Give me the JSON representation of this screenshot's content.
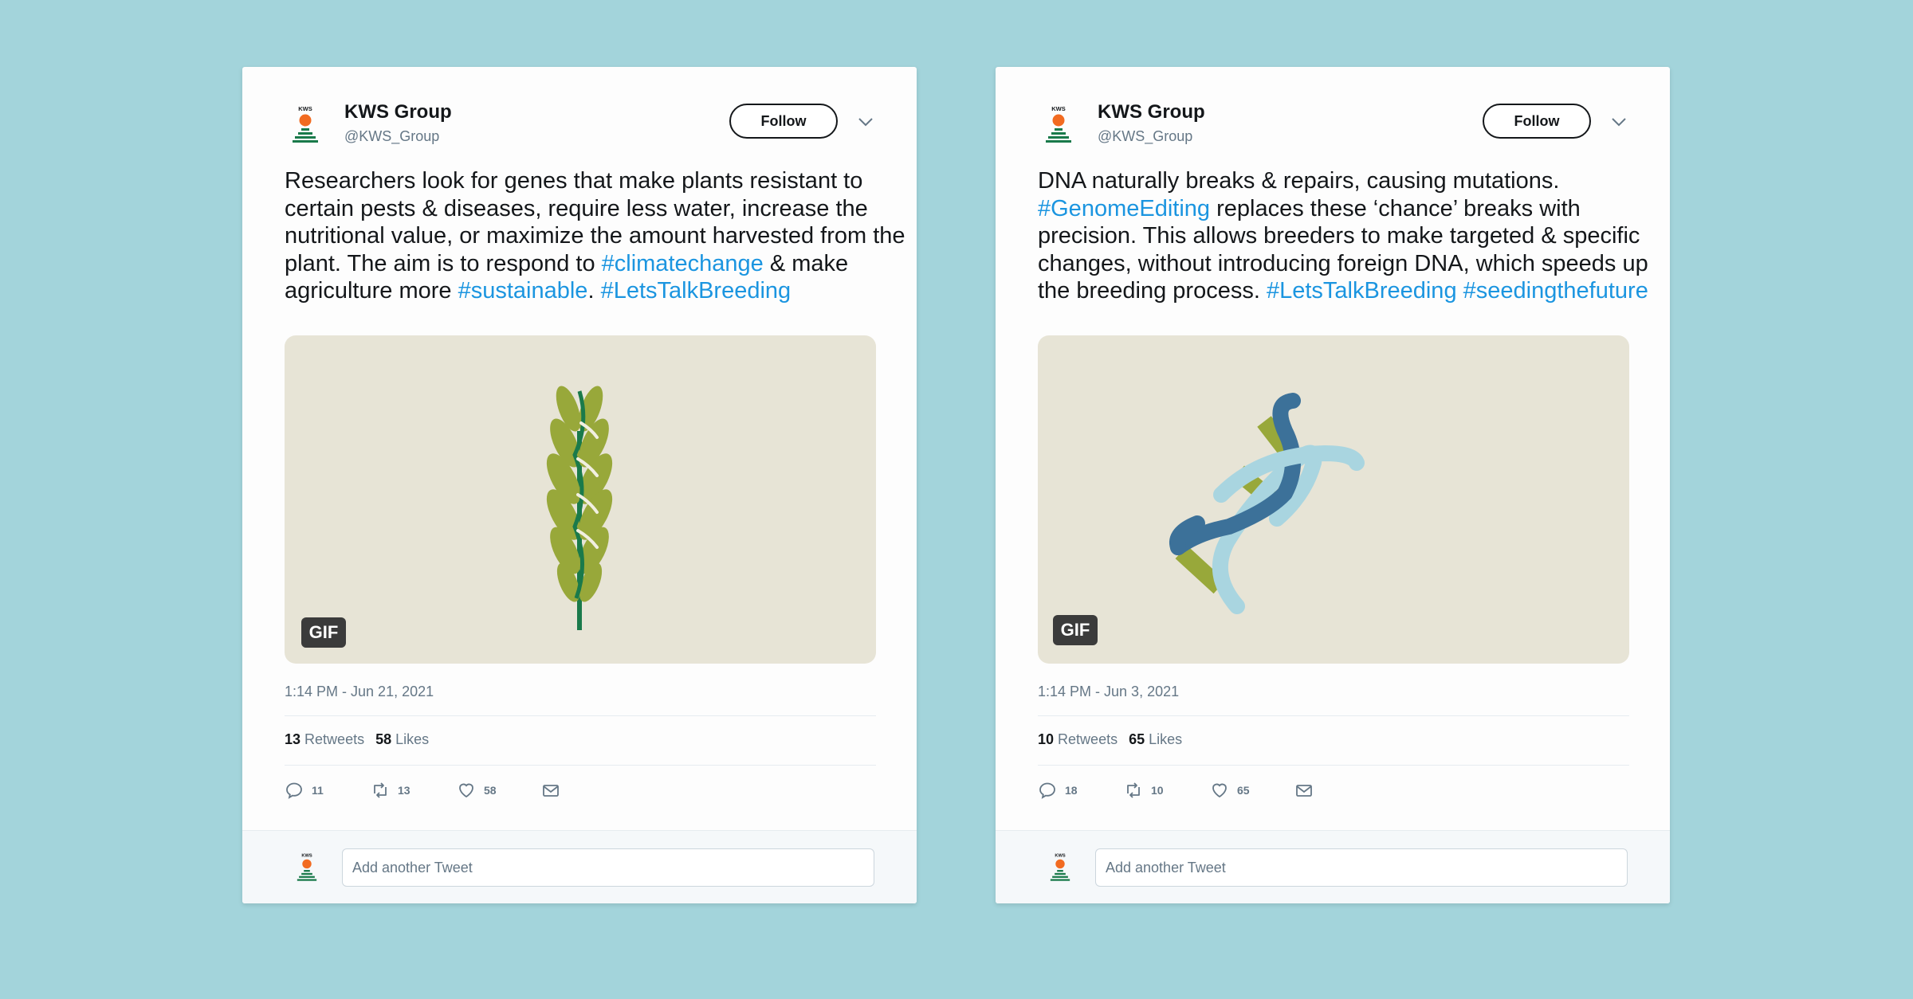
{
  "colors": {
    "background": "#a3d4db",
    "hashtag": "#1b95e0",
    "text": "#14171a",
    "muted": "#657786"
  },
  "tweets": [
    {
      "author": {
        "name": "KWS Group",
        "handle": "@KWS_Group",
        "logo_text": "KWS"
      },
      "follow_label": "Follow",
      "text_parts": [
        "Researchers look for genes that make plants resistant to certain pests & diseases, require less water, increase the nutritional value, or maximize the amount harvested from the plant. The aim is to respond to ",
        "#climatechange",
        " & make agriculture more ",
        "#sustainable",
        ". ",
        "#LetsTalkBreeding"
      ],
      "media_badge": "GIF",
      "media_icon": "wheat-ear-icon",
      "timestamp": "1:14 PM - Jun 21, 2021",
      "retweets": "13",
      "retweets_label": "Retweets",
      "likes": "58",
      "likes_label": "Likes",
      "actions": {
        "reply": "11",
        "retweet": "13",
        "like": "58"
      },
      "reply_placeholder": "Add another Tweet"
    },
    {
      "author": {
        "name": "KWS Group",
        "handle": "@KWS_Group",
        "logo_text": "KWS"
      },
      "follow_label": "Follow",
      "text_parts": [
        "DNA naturally breaks & repairs, causing mutations. ",
        "#GenomeEditing",
        " replaces these ‘chance’ breaks with precision. This allows breeders to make targeted & specific changes, without introducing foreign DNA, which speeds up the breeding process. ",
        "#LetsTalkBreeding",
        " ",
        "#seedingthefuture"
      ],
      "media_badge": "GIF",
      "media_icon": "dna-helix-icon",
      "timestamp": "1:14 PM - Jun 3, 2021",
      "retweets": "10",
      "retweets_label": "Retweets",
      "likes": "65",
      "likes_label": "Likes",
      "actions": {
        "reply": "18",
        "retweet": "10",
        "like": "65"
      },
      "reply_placeholder": "Add another Tweet"
    }
  ]
}
